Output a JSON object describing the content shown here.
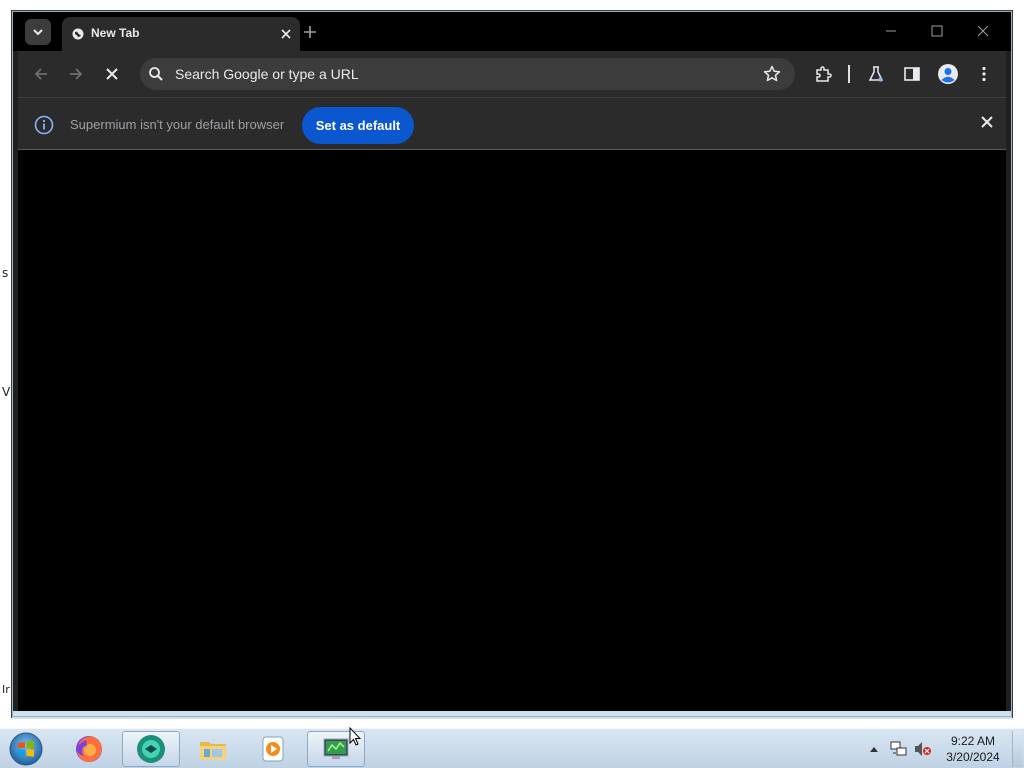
{
  "browser": {
    "tab": {
      "title": "New Tab",
      "favicon": "globe-icon"
    },
    "omnibox": {
      "placeholder": "Search Google or type a URL"
    },
    "infobar": {
      "message": "Supermium isn't your default browser",
      "button_label": "Set as default"
    },
    "toolbar_icons": [
      "back-icon",
      "forward-icon",
      "stop-loading-icon",
      "star-icon",
      "extensions-icon",
      "labs-flask-icon",
      "side-panel-icon",
      "profile-icon",
      "more-menu-icon"
    ],
    "colors": {
      "accent_button": "#0b57d0",
      "info_icon": "#8ab4f8",
      "chrome_bg": "#2b2b2b",
      "tabstrip_bg": "#000000"
    }
  },
  "desktop_fragments": [
    "s",
    "V",
    "Ir"
  ],
  "taskbar": {
    "apps": [
      "firefox-icon",
      "supermium-icon",
      "file-explorer-icon",
      "media-player-icon",
      "remote-desktop-icon"
    ],
    "clock": {
      "time": "9:22 AM",
      "date": "3/20/2024"
    },
    "tray_icons": [
      "show-hidden-icons",
      "network-icon",
      "volume-muted-icon"
    ]
  }
}
